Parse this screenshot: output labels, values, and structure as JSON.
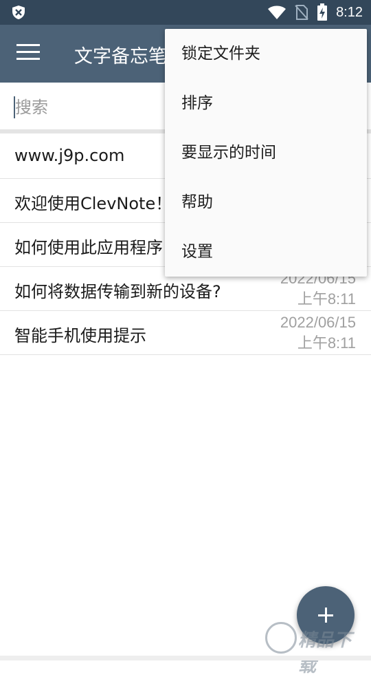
{
  "status_bar": {
    "time": "8:12",
    "icons": [
      "shield-icon",
      "wifi-icon",
      "no-sim-icon",
      "battery-charging-icon"
    ]
  },
  "app_bar": {
    "title": "文字备忘笔记",
    "menu_icon": "hamburger-menu-icon"
  },
  "search": {
    "placeholder": "搜索",
    "value": ""
  },
  "notes": [
    {
      "title": "www.j9p.com",
      "date": "",
      "time": ""
    },
    {
      "title": "欢迎使用ClevNote！",
      "date": "",
      "time": ""
    },
    {
      "title": "如何使用此应用程序",
      "date": "",
      "time": ""
    },
    {
      "title": "如何将数据传输到新的设备?",
      "date": "2022/06/15",
      "time": "上午8:11"
    },
    {
      "title": "智能手机使用提示",
      "date": "2022/06/15",
      "time": "上午8:11"
    }
  ],
  "overflow_menu": {
    "items": [
      "锁定文件夹",
      "排序",
      "要显示的时间",
      "帮助",
      "设置"
    ]
  },
  "fab": {
    "icon": "plus-icon"
  },
  "watermark": {
    "text": "精品下载"
  },
  "colors": {
    "status_bar": "#33475a",
    "app_bar": "#4c6277",
    "fab": "#4c6277"
  }
}
